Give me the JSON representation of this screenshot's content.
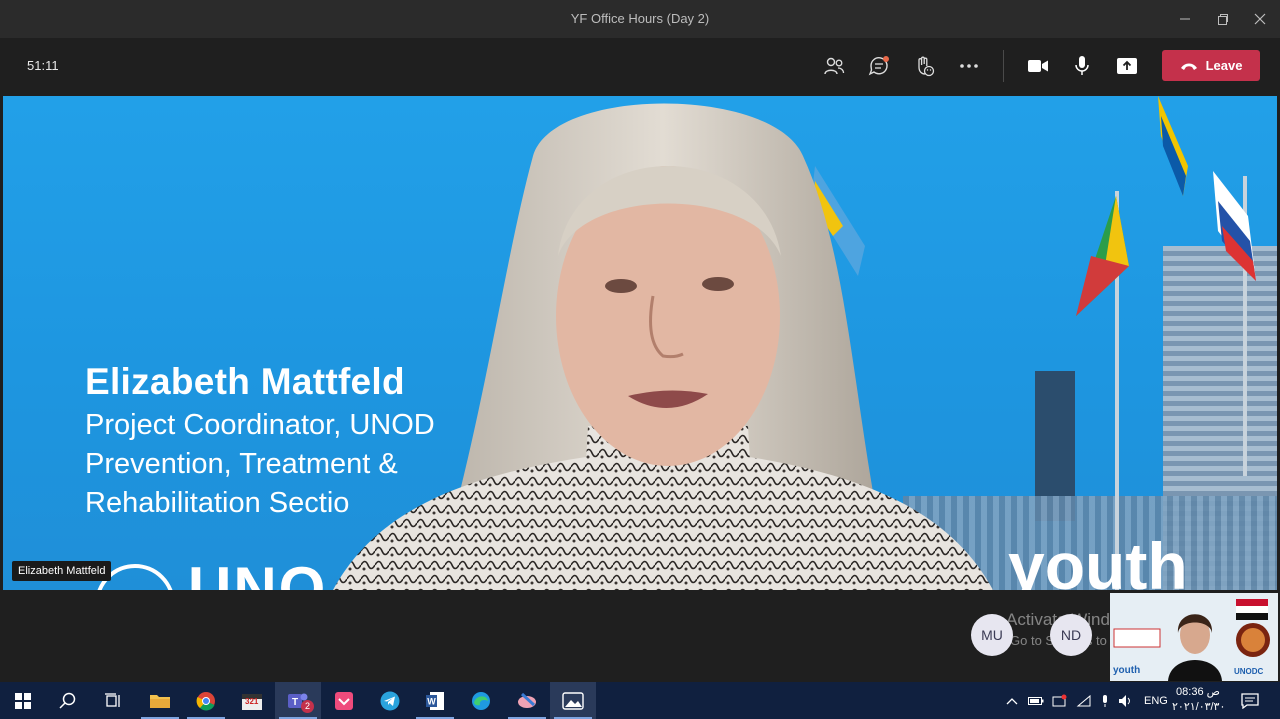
{
  "window": {
    "title": "YF Office Hours (Day 2)"
  },
  "toolbar": {
    "timer": "51:11",
    "leave_label": "Leave",
    "icons": [
      "people-icon",
      "chat-icon",
      "raise-hand-icon",
      "more-icon",
      "camera-icon",
      "mic-icon",
      "share-icon"
    ]
  },
  "video": {
    "speaker_name": "Elizabeth Mattfeld",
    "slide_name": "Elizabeth Mattfeld",
    "slide_line1": "Project Coordinator, UNOD",
    "slide_line2": "Prevention, Treatment &",
    "slide_line3": "Rehabilitation Sectio",
    "slide_logo_text": "UNO",
    "slide_youth_text": "youth"
  },
  "participants": [
    {
      "initials": "MU"
    },
    {
      "initials": "ND"
    }
  ],
  "watermark": {
    "line1": "Activate Windows",
    "line2": "Go to Settings to activate Windows."
  },
  "selfview": {
    "badge": "youth",
    "logo_text": "UNODC"
  },
  "taskbar": {
    "language": "ENG",
    "clock_time": "08:36 ص",
    "clock_date": "٢٠٢١/٠٣/٣٠",
    "teams_badge": "2",
    "calendar_label": "321"
  },
  "colors": {
    "leave": "#c4314b",
    "slide_blue": "#22a0e8",
    "taskbar": "#10203f"
  }
}
